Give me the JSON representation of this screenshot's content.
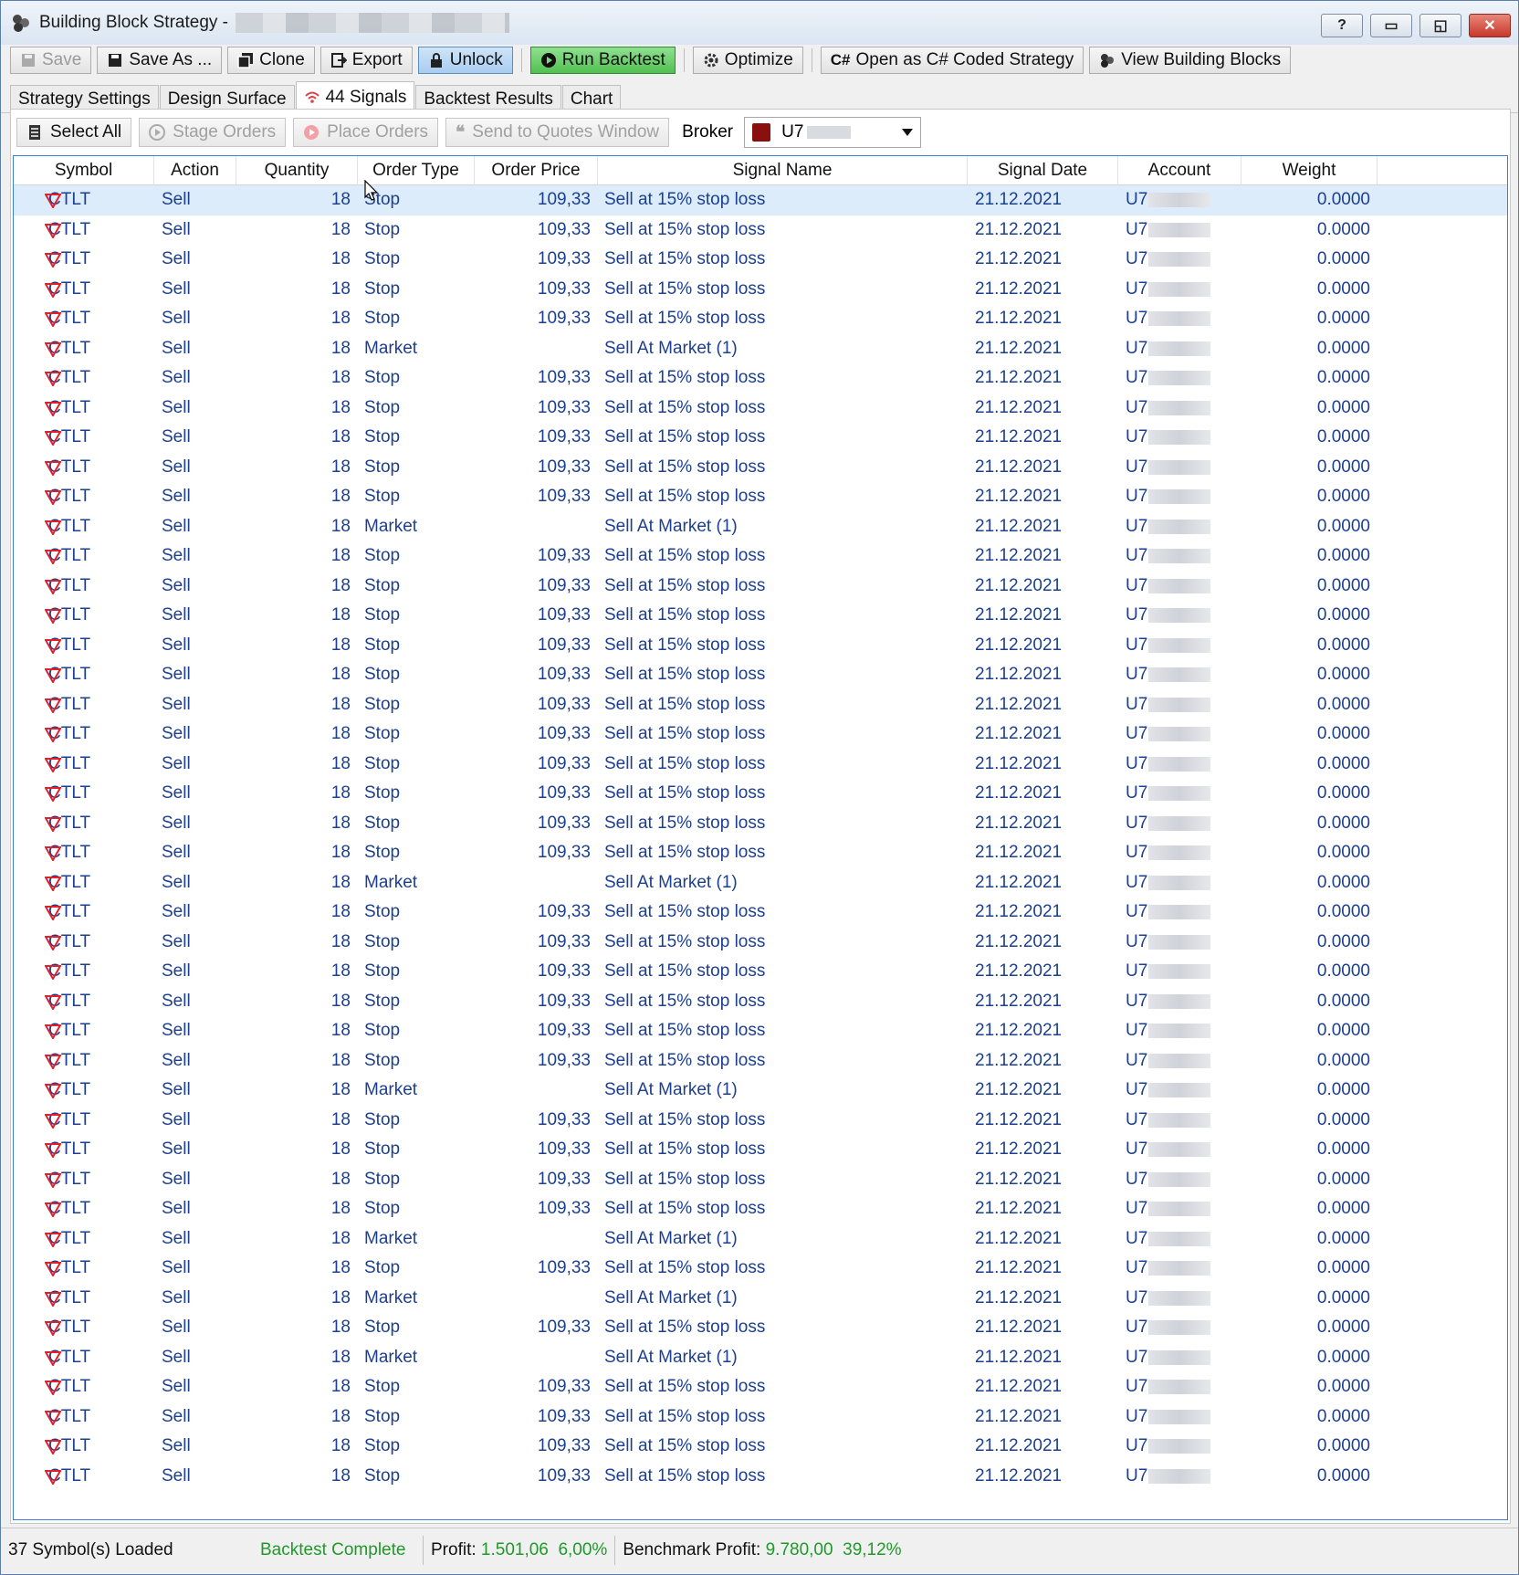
{
  "window": {
    "title": "Building Block Strategy -",
    "controls": [
      "?",
      "▭",
      "◱",
      "✕"
    ]
  },
  "toolbar": {
    "save": "Save",
    "save_as": "Save As ...",
    "clone": "Clone",
    "export": "Export",
    "unlock": "Unlock",
    "run_backtest": "Run Backtest",
    "optimize": "Optimize",
    "open_csharp": "Open as C# Coded Strategy",
    "view_blocks": "View Building Blocks"
  },
  "tabs": [
    {
      "label": "Strategy Settings"
    },
    {
      "label": "Design Surface"
    },
    {
      "label": "44 Signals"
    },
    {
      "label": "Backtest Results"
    },
    {
      "label": "Chart"
    }
  ],
  "signals_toolbar": {
    "select_all": "Select All",
    "stage_orders": "Stage Orders",
    "place_orders": "Place Orders",
    "send_quotes": "Send to Quotes Window",
    "broker_label": "Broker",
    "broker_value": "U7"
  },
  "columns": [
    "Symbol",
    "Action",
    "Quantity",
    "Order Type",
    "Order Price",
    "Signal Name",
    "Signal Date",
    "Account",
    "Weight"
  ],
  "row_template": {
    "symbol": "CTLT",
    "action": "Sell",
    "quantity": "18",
    "date": "21.12.2021",
    "account": "U7",
    "weight": "0.0000"
  },
  "order_kinds": {
    "stop": {
      "type": "Stop",
      "price": "109,33",
      "signal": "Sell at 15% stop loss"
    },
    "market": {
      "type": "Market",
      "price": "",
      "signal": "Sell At Market (1)"
    }
  },
  "rows": [
    "stop",
    "stop",
    "stop",
    "stop",
    "stop",
    "market",
    "stop",
    "stop",
    "stop",
    "stop",
    "stop",
    "market",
    "stop",
    "stop",
    "stop",
    "stop",
    "stop",
    "stop",
    "stop",
    "stop",
    "stop",
    "stop",
    "stop",
    "market",
    "stop",
    "stop",
    "stop",
    "stop",
    "stop",
    "stop",
    "market",
    "stop",
    "stop",
    "stop",
    "stop",
    "market",
    "stop",
    "market",
    "stop",
    "market",
    "stop",
    "stop",
    "stop",
    "stop"
  ],
  "selected_row": 0,
  "status": {
    "symbols_loaded": "37 Symbol(s) Loaded",
    "backtest": "Backtest Complete",
    "profit_label": "Profit:",
    "profit_value": "1.501,06",
    "profit_pct": "6,00%",
    "bench_label": "Benchmark Profit:",
    "bench_value": "9.780,00",
    "bench_pct": "39,12%"
  },
  "colors": {
    "row_text": "#1c3f8f",
    "down_arrow": "#e0202a",
    "status_green": "#1f9a2a",
    "selection": "#dcecfb"
  }
}
